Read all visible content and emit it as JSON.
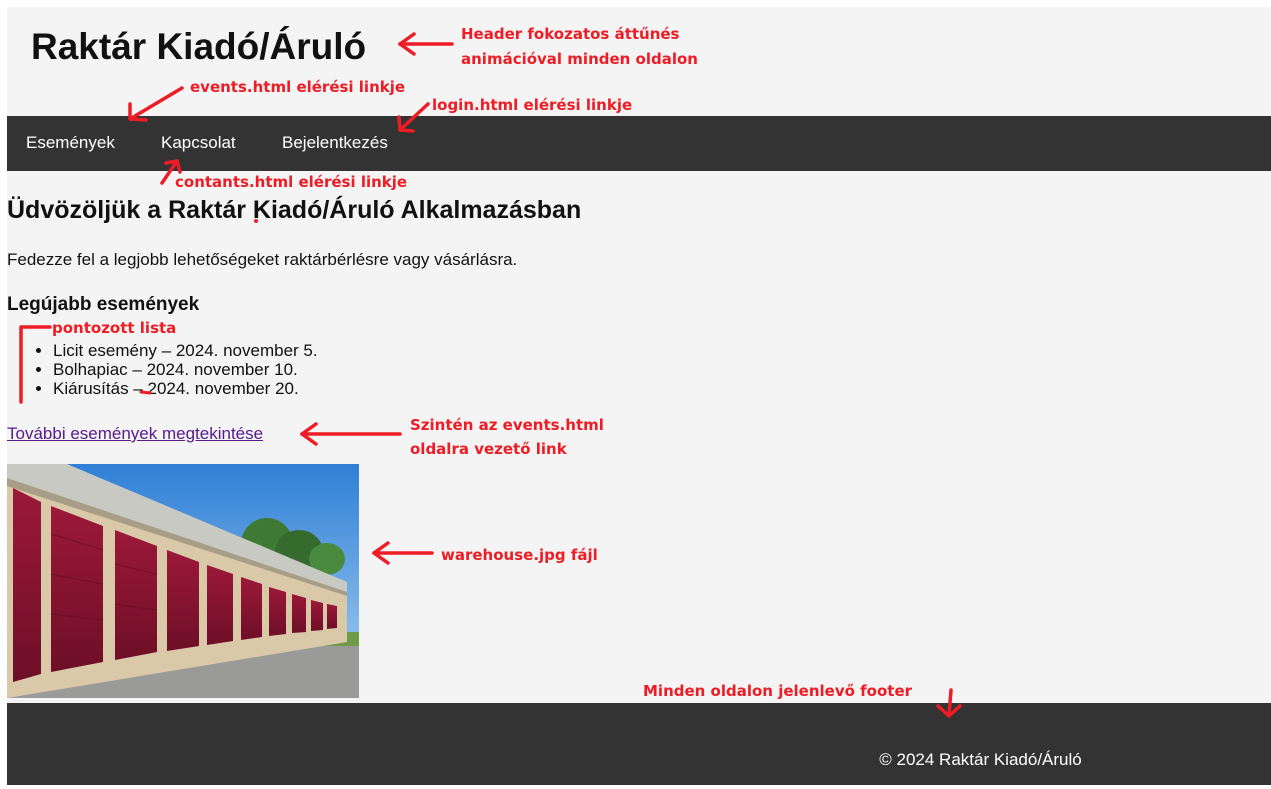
{
  "header": {
    "title": "Raktár Kiadó/Áruló"
  },
  "nav": {
    "items": [
      {
        "label": "Események"
      },
      {
        "label": "Kapcsolat"
      },
      {
        "label": "Bejelentkezés"
      }
    ]
  },
  "main": {
    "heading": "Üdvözöljük a Raktár Kiadó/Áruló Alkalmazásban",
    "intro": "Fedezze fel a legjobb lehetőségeket raktárbérlésre vagy vásárlásra.",
    "events_heading": "Legújabb események",
    "events": [
      "Licit esemény – 2024. november 5.",
      "Bolhapiac – 2024. november 10.",
      "Kiárusítás – 2024. november 20."
    ],
    "more_events_link": "További események megtekintése"
  },
  "footer": {
    "text": "© 2024 Raktár Kiadó/Áruló"
  },
  "annotations": {
    "header_note_line1": "Header fokozatos áttűnés",
    "header_note_line2": "animációval minden oldalon",
    "events_link_note": "events.html elérési linkje",
    "login_link_note": "login.html elérési linkje",
    "contacts_link_note": "contants.html elérési linkje",
    "bullet_list_note": "pontozott lista",
    "more_link_note_line1": "Szintén az events.html",
    "more_link_note_line2": "oldalra vezető link",
    "image_note": "warehouse.jpg fájl",
    "footer_note": "Minden oldalon jelenlevő footer"
  },
  "colors": {
    "page_background": "#f4f4f4",
    "nav_background": "#333333",
    "footer_background": "#333333",
    "annotation_red": "#ee1c24",
    "visited_link": "#551a8b"
  }
}
